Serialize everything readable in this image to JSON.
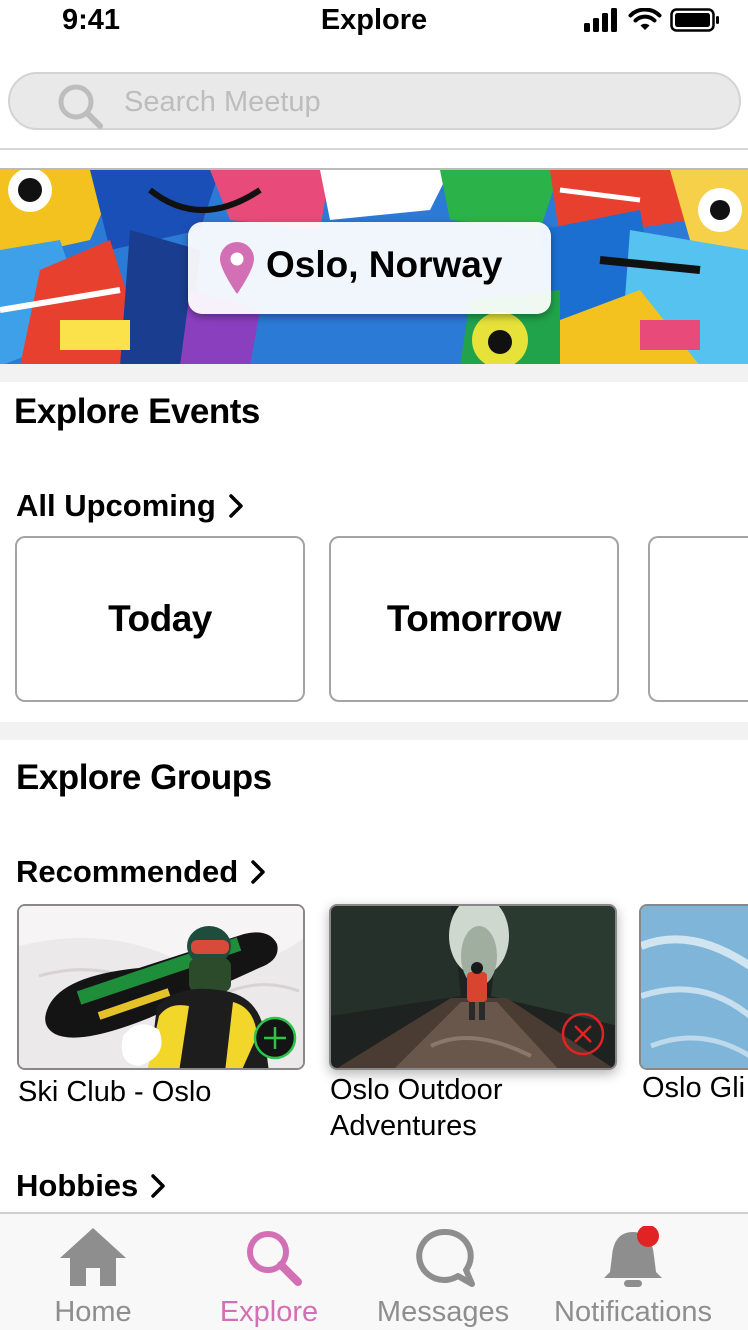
{
  "status_bar": {
    "time": "9:41",
    "title": "Explore"
  },
  "search": {
    "placeholder": "Search Meetup"
  },
  "location": {
    "label": "Oslo, Norway"
  },
  "events": {
    "title": "Explore Events",
    "upcoming_label": "All Upcoming",
    "days": [
      {
        "label": "Today"
      },
      {
        "label": "Tomorrow"
      },
      {
        "label": ""
      }
    ]
  },
  "groups": {
    "title": "Explore Groups",
    "recommended_label": "Recommended",
    "cards": [
      {
        "name": "Ski Club - Oslo",
        "action": "join"
      },
      {
        "name": "Oslo Outdoor Adventures",
        "action": "leave"
      },
      {
        "name": "Oslo Gli"
      }
    ],
    "hobbies_label": "Hobbies"
  },
  "tabs": [
    {
      "label": "Home",
      "icon": "home-icon"
    },
    {
      "label": "Explore",
      "icon": "search-icon",
      "active": true
    },
    {
      "label": "Messages",
      "icon": "chat-bubble-icon"
    },
    {
      "label": "Notifications",
      "icon": "bell-icon",
      "badge": true
    }
  ],
  "colors": {
    "accent": "#d36fb4",
    "tab_inactive": "#8e8e8e",
    "join": "#2ec24a",
    "leave": "#e02424",
    "badge": "#e02424"
  }
}
